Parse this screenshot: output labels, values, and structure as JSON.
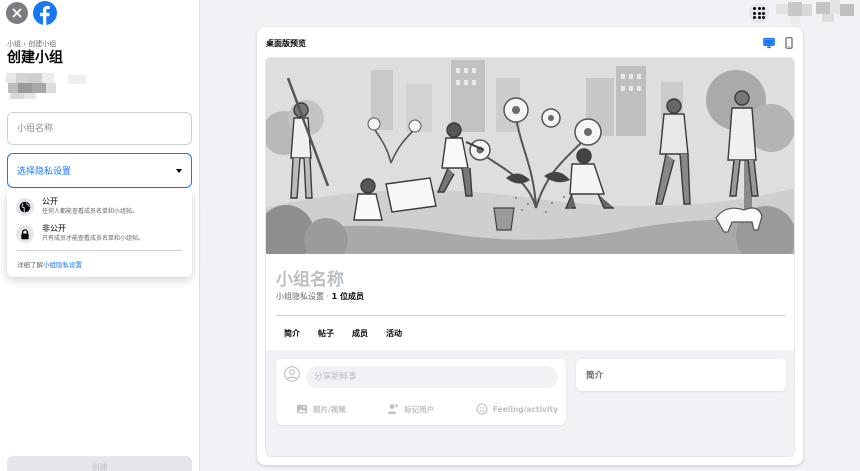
{
  "sidebar": {
    "breadcrumb": "小组 › 创建小组",
    "title": "创建小组",
    "name_placeholder": "小组名称",
    "privacy_placeholder": "选择隐私设置",
    "options": [
      {
        "title": "公开",
        "description": "任何人都能查看成员名单和小组帖。",
        "icon": "globe-icon"
      },
      {
        "title": "非公开",
        "description": "只有成员才能查看成员名单和小组帖。",
        "icon": "lock-icon"
      }
    ],
    "learn_more_prefix": "详细了解",
    "learn_more_link": "小组隐私设置",
    "create_label": "创建"
  },
  "preview": {
    "label": "桌面版预览",
    "group_name": "小组名称",
    "privacy_text": "小组隐私设置 · ",
    "members_text": "1 位成员",
    "tabs": [
      "简介",
      "帖子",
      "成员",
      "活动"
    ],
    "composer_placeholder": "分享新鲜事",
    "actions": [
      {
        "label": "照片/视频",
        "icon": "photo-icon"
      },
      {
        "label": "标记用户",
        "icon": "tag-people-icon"
      },
      {
        "label": "Feeling/activity",
        "icon": "feeling-icon"
      }
    ],
    "about_title": "简介"
  },
  "colors": {
    "brand_blue": "#1877f2",
    "page_bg": "#f0f2f5",
    "muted_text": "#65676b"
  }
}
